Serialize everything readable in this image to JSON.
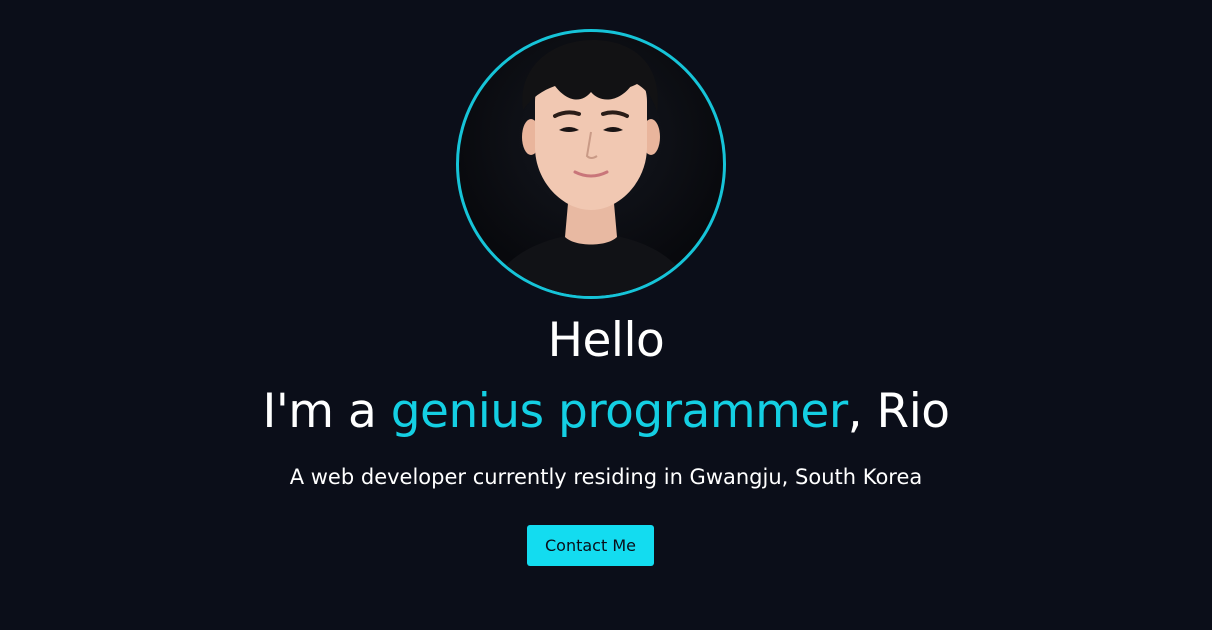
{
  "hero": {
    "greeting": "Hello",
    "headline_prefix": "I'm a ",
    "headline_accent": "genius programmer",
    "headline_suffix": ", Rio",
    "subtitle": "A web developer currently residing in Gwangju, South Korea",
    "contact_button_label": "Contact Me"
  },
  "colors": {
    "background": "#0b0e19",
    "accent": "#14cfe3",
    "button": "#13dcf0",
    "text": "#ffffff"
  },
  "avatar": {
    "icon": "profile-photo"
  }
}
